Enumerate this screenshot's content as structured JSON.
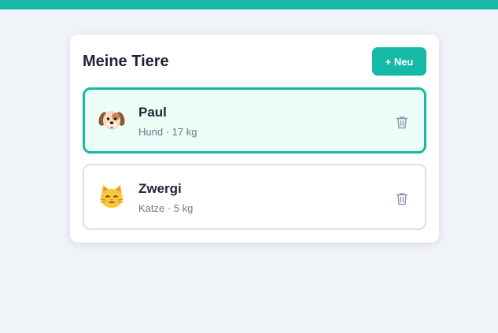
{
  "app": {
    "accent_color": "#16b8a6"
  },
  "header": {
    "title": "Meine Tiere",
    "new_button_label": "+ Neu"
  },
  "pets": [
    {
      "name": "Paul",
      "details": "Hund · 17 kg",
      "icon": "dog-icon",
      "selected": true,
      "action_icon": "trash-icon"
    },
    {
      "name": "Zwergi",
      "details": "Katze · 5 kg",
      "icon": "cat-icon",
      "selected": false,
      "action_icon": "trash-icon"
    }
  ]
}
